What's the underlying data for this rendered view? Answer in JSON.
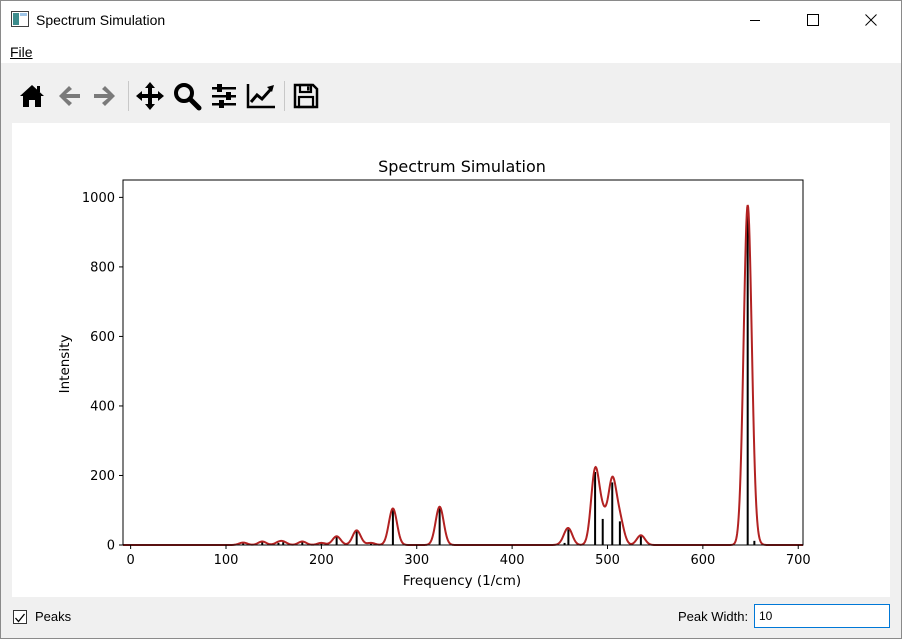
{
  "window": {
    "title": "Spectrum Simulation",
    "icons": {
      "app": "app-window-icon",
      "minimize": "minimize-icon",
      "maximize": "maximize-icon",
      "close": "close-icon"
    }
  },
  "menu": {
    "file_label": "File"
  },
  "toolbar": {
    "tools": [
      {
        "name": "home-icon"
      },
      {
        "name": "back-arrow-icon"
      },
      {
        "name": "forward-arrow-icon"
      },
      {
        "name": "pan-move-icon"
      },
      {
        "name": "zoom-magnifier-icon"
      },
      {
        "name": "subplots-config-icon"
      },
      {
        "name": "edit-axis-curve-icon"
      },
      {
        "name": "save-floppy-icon"
      }
    ]
  },
  "controls": {
    "peaks_label": "Peaks",
    "peaks_checked": true,
    "peak_width_label": "Peak Width:",
    "peak_width_value": "10"
  },
  "chart_data": {
    "type": "line",
    "title": "Spectrum Simulation",
    "xlabel": "Frequency (1/cm)",
    "ylabel": "Intensity",
    "xlim": [
      -8,
      705
    ],
    "ylim": [
      0,
      1050
    ],
    "xticks": [
      0,
      100,
      200,
      300,
      400,
      500,
      600,
      700
    ],
    "yticks": [
      0,
      200,
      400,
      600,
      800,
      1000
    ],
    "grid": false,
    "colors": {
      "curve": "#b22222",
      "sticks": "#000000"
    },
    "peak_width": 10,
    "peaks": [
      {
        "x": 118,
        "y": 7
      },
      {
        "x": 138,
        "y": 10
      },
      {
        "x": 155,
        "y": 6
      },
      {
        "x": 160,
        "y": 8
      },
      {
        "x": 180,
        "y": 10
      },
      {
        "x": 200,
        "y": 6
      },
      {
        "x": 216,
        "y": 25
      },
      {
        "x": 237,
        "y": 42
      },
      {
        "x": 252,
        "y": 6
      },
      {
        "x": 275,
        "y": 105
      },
      {
        "x": 324,
        "y": 110
      },
      {
        "x": 455,
        "y": 6
      },
      {
        "x": 459,
        "y": 45
      },
      {
        "x": 487,
        "y": 210
      },
      {
        "x": 495,
        "y": 75
      },
      {
        "x": 505,
        "y": 180
      },
      {
        "x": 513,
        "y": 68
      },
      {
        "x": 535,
        "y": 28
      },
      {
        "x": 647,
        "y": 975
      },
      {
        "x": 654,
        "y": 12
      }
    ]
  }
}
